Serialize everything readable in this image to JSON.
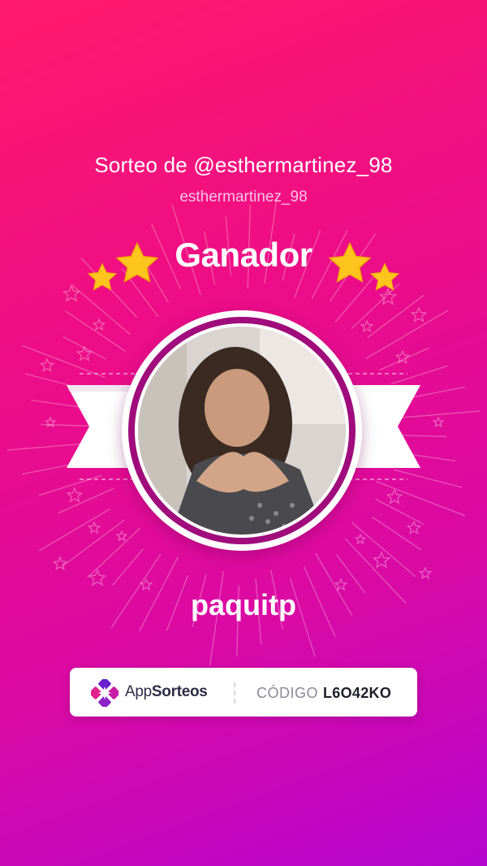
{
  "header": {
    "title": "Sorteo de @esthermartinez_98",
    "subtitle": "esthermartinez_98"
  },
  "badge": {
    "label": "Ganador"
  },
  "winner": {
    "username": "paquitp"
  },
  "footer": {
    "brand_prefix": "App",
    "brand_suffix": "Sorteos",
    "code_label": "CÓDIGO",
    "code_value": "L6O42KO"
  },
  "colors": {
    "background_top": "#ff1a6b",
    "background_bottom": "#b505d0",
    "star": "#ffc51f",
    "ring": "#a00c7c"
  },
  "icons": [
    "star-icon",
    "appsorteos-logo-icon"
  ]
}
